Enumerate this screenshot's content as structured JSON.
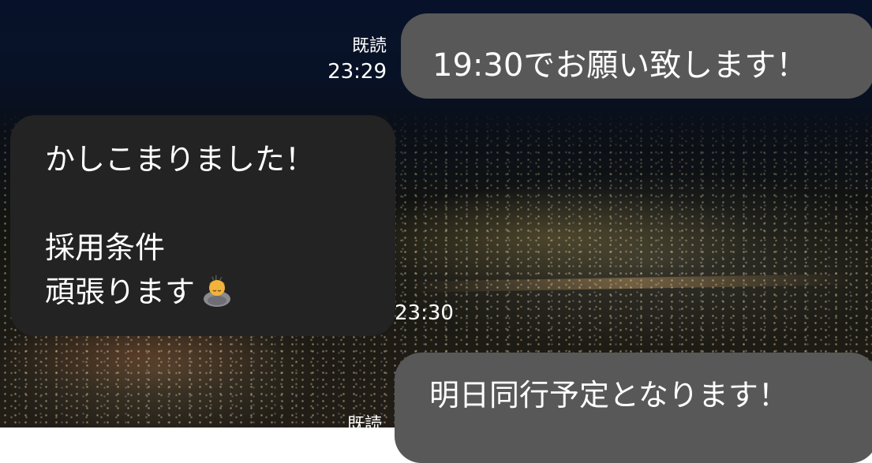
{
  "messages": [
    {
      "direction": "outgoing",
      "lines": [
        "19:30でお願い致します！"
      ],
      "read_label": "既読",
      "time": "23:29"
    },
    {
      "direction": "incoming",
      "lines": [
        "かしこまりました！",
        "",
        "採用条件",
        "頑張ります"
      ],
      "emoji": "bowing-person-icon",
      "time": "23:30"
    },
    {
      "direction": "outgoing",
      "lines": [
        "明日同行予定となります！"
      ],
      "read_label": "既読"
    }
  ],
  "colors": {
    "outgoing_bubble": "#585858",
    "incoming_bubble": "#232323",
    "text": "#ffffff"
  }
}
